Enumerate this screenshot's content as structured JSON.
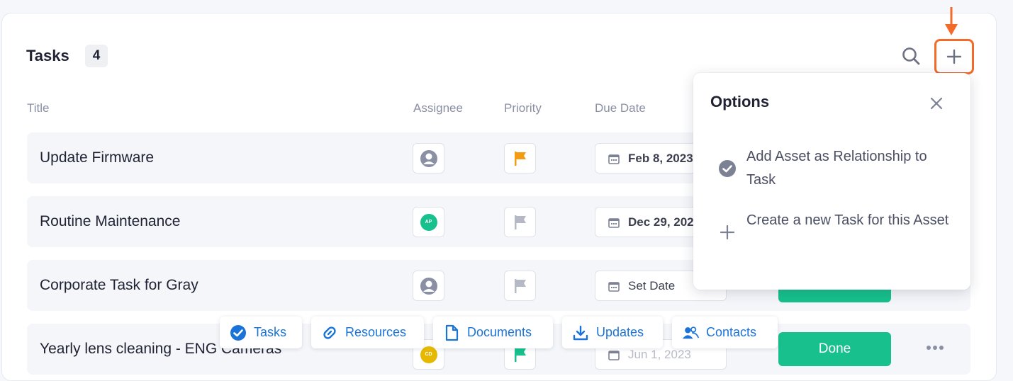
{
  "header": {
    "title": "Tasks",
    "count": "4"
  },
  "columns": {
    "title": "Title",
    "assignee": "Assignee",
    "priority": "Priority",
    "due_date": "Due Date"
  },
  "rows": [
    {
      "title": "Update Firmware",
      "assignee": "placeholder-user-icon",
      "priority": "orange-flag-icon",
      "due": "Feb 8, 2023",
      "status": ""
    },
    {
      "title": "Routine Maintenance",
      "assignee": "AP",
      "priority": "gray-flag-icon",
      "due": "Dec 29, 2023",
      "status": ""
    },
    {
      "title": "Corporate Task for Gray",
      "assignee": "placeholder-user-icon",
      "priority": "gray-flag-icon",
      "due": "Set Date",
      "status": "Done"
    },
    {
      "title": "Yearly lens cleaning - ENG Cameras",
      "assignee": "CD",
      "priority": "green-flag-icon",
      "due": "Jun 1, 2023",
      "status": "Done"
    }
  ],
  "options_popover": {
    "title": "Options",
    "items": [
      {
        "label": "Add Asset as Relationship to Task",
        "icon": "check-circle-icon"
      },
      {
        "label": "Create a new Task for this Asset",
        "icon": "plus-icon"
      }
    ]
  },
  "tabbar": {
    "tabs": [
      {
        "label": "Tasks",
        "icon": "check-circle-icon"
      },
      {
        "label": "Resources",
        "icon": "link-icon"
      },
      {
        "label": "Documents",
        "icon": "document-icon"
      },
      {
        "label": "Updates",
        "icon": "download-icon"
      },
      {
        "label": "Contacts",
        "icon": "contacts-icon"
      }
    ]
  },
  "colors": {
    "accent": "#1a73d9",
    "highlight": "#f26b2b",
    "done": "#17c08c",
    "flag_orange": "#f39c12",
    "avatar_ap": "#17c08c",
    "avatar_cd": "#e6b800"
  }
}
